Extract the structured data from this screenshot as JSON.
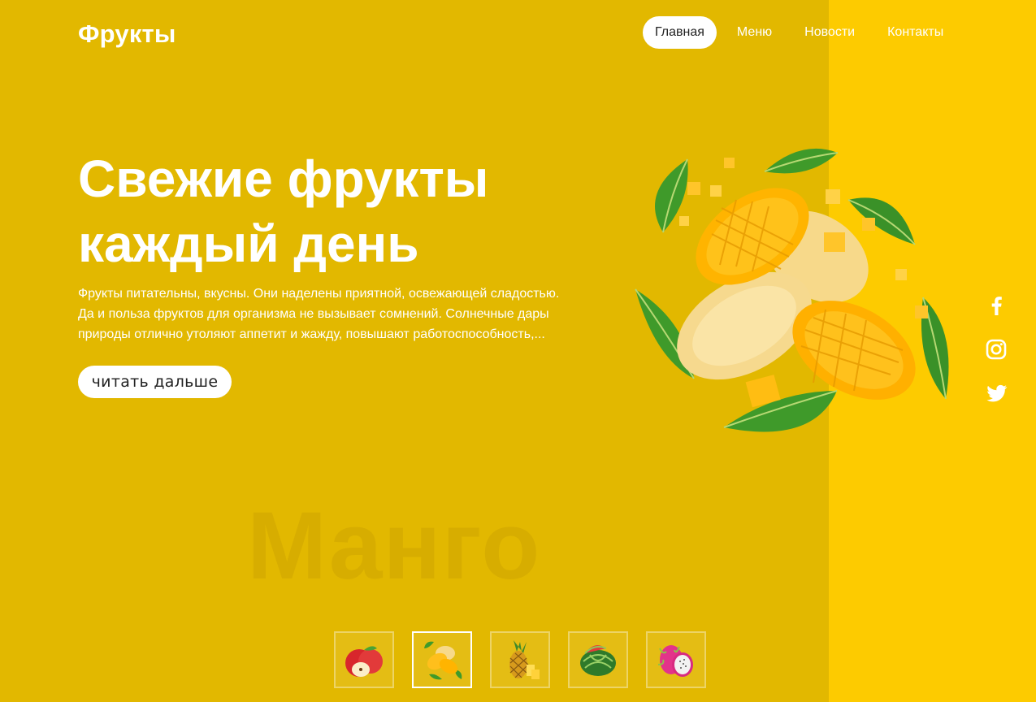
{
  "brand": {
    "logo_text": "Фрукты"
  },
  "nav": {
    "items": [
      {
        "label": "Главная",
        "active": true
      },
      {
        "label": "Меню",
        "active": false
      },
      {
        "label": "Новости",
        "active": false
      },
      {
        "label": "Контакты",
        "active": false
      }
    ]
  },
  "hero": {
    "title_line1": "Свежие фрукты",
    "title_line2": "каждый день",
    "text": "Фрукты питательны, вкусны. Они наделены приятной, освежающей сладостью. Да и польза фруктов для организма не вызывает сомнений. Солнечные дары природы отлично утоляют аппетит и жажду, повышают работоспособность,...",
    "button_label": "читать дальше"
  },
  "watermark": "Манго",
  "social": [
    "facebook-icon",
    "instagram-icon",
    "twitter-icon"
  ],
  "thumbnails": [
    {
      "icon": "apple-icon",
      "active": false
    },
    {
      "icon": "mango-icon",
      "active": true
    },
    {
      "icon": "pineapple-icon",
      "active": false
    },
    {
      "icon": "watermelon-icon",
      "active": false
    },
    {
      "icon": "dragonfruit-icon",
      "active": false
    }
  ],
  "colors": {
    "background": "#e2b800",
    "side_panel": "#fdcb00",
    "text": "#ffffff",
    "button_bg": "#ffffff"
  }
}
